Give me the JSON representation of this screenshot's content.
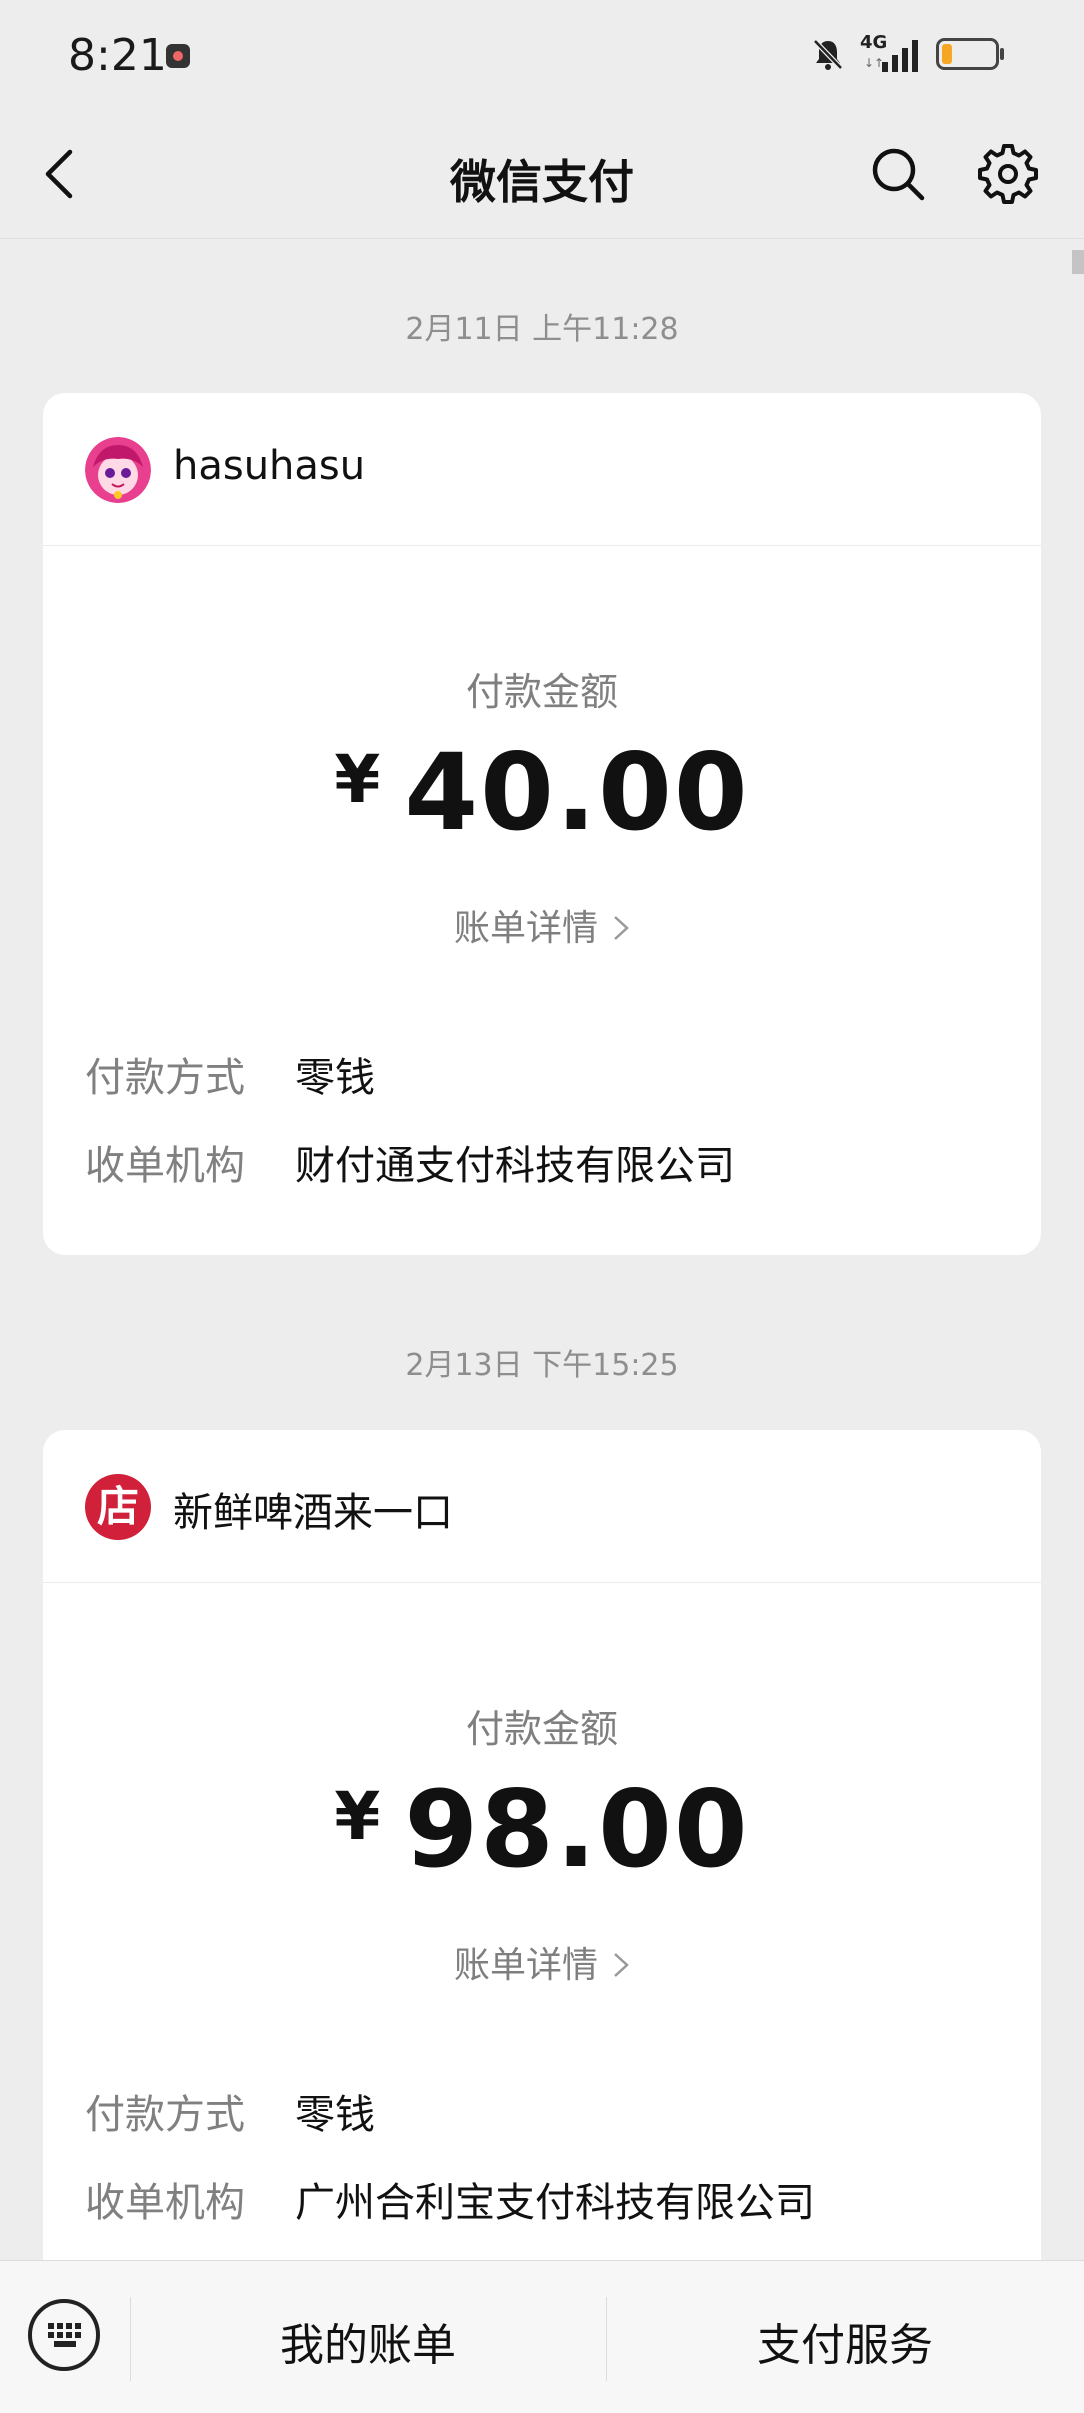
{
  "status_bar": {
    "time": "8:21",
    "network": "4G",
    "network_sub": "↓↑",
    "battery_percent": 15
  },
  "header": {
    "title": "微信支付"
  },
  "transactions": [
    {
      "timestamp": "2月11日 上午11:28",
      "merchant": "hasuhasu",
      "amount_label": "付款金额",
      "currency": "¥",
      "amount": "40.00",
      "detail_link": "账单详情",
      "payment_method_label": "付款方式",
      "payment_method": "零钱",
      "acquirer_label": "收单机构",
      "acquirer": "财付通支付科技有限公司"
    },
    {
      "timestamp": "2月13日 下午15:25",
      "merchant": "新鲜啤酒来一口",
      "merchant_icon_text": "店",
      "amount_label": "付款金额",
      "currency": "¥",
      "amount": "98.00",
      "detail_link": "账单详情",
      "payment_method_label": "付款方式",
      "payment_method": "零钱",
      "acquirer_label": "收单机构",
      "acquirer": "广州合利宝支付科技有限公司"
    }
  ],
  "bottom_bar": {
    "my_bills": "我的账单",
    "pay_services": "支付服务"
  },
  "colors": {
    "background": "#ededed",
    "card": "#ffffff",
    "shop_icon": "#d1203a",
    "battery": "#f5a623"
  }
}
